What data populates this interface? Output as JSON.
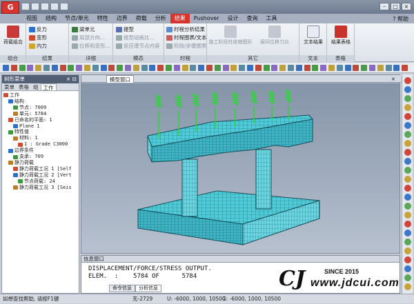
{
  "app": {
    "logo_text": "G"
  },
  "menubar": {
    "tabs": [
      "视图",
      "结构",
      "节点/单元",
      "特性",
      "边界",
      "荷载",
      "分析",
      "结果",
      "Pushover",
      "设计",
      "查询",
      "工具"
    ],
    "active_index": 7,
    "help_label": "帮助"
  },
  "ribbon": {
    "groups": {
      "combo": {
        "label": "组合",
        "button": "荷载组合"
      },
      "result": {
        "label": "结果",
        "items": [
          "反力",
          "变形",
          "内力"
        ],
        "items2": [
          "梁单元",
          "局部方向...",
          "位移和变形..."
        ]
      },
      "detail": {
        "label": "详细"
      },
      "mode": {
        "label": "模态",
        "items": [
          "振型",
          "振型动画比...",
          "反应谱节点内容"
        ]
      },
      "time": {
        "label": "时程",
        "items": [
          "时程分析结果",
          "时程图表/文本",
          "阶段/步骤图表"
        ]
      },
      "other": {
        "label": "其它",
        "items": [
          "施工阶段柱收缩图形",
          "层间位移力比"
        ]
      },
      "text": {
        "label": "文本",
        "button": "文本结果"
      },
      "table": {
        "label": "表格",
        "button": "结果表格"
      }
    }
  },
  "left_panel": {
    "title": "树形菜单",
    "tabs": [
      "菜单",
      "表格",
      "组",
      "工作"
    ],
    "active_tab": 3,
    "tree": [
      {
        "level": 0,
        "text": "工作"
      },
      {
        "level": 1,
        "text": "结构"
      },
      {
        "level": 2,
        "text": "节点: 7009"
      },
      {
        "level": 2,
        "text": "单元: 5784"
      },
      {
        "level": 1,
        "text": "已命名的平面: 1"
      },
      {
        "level": 2,
        "text": "Plane 1"
      },
      {
        "level": 1,
        "text": "特性值"
      },
      {
        "level": 2,
        "text": "材料: 1"
      },
      {
        "level": 3,
        "text": "1 : Grade C3000"
      },
      {
        "level": 1,
        "text": "边界条件"
      },
      {
        "level": 2,
        "text": "支承: 709"
      },
      {
        "level": 1,
        "text": "静力荷载"
      },
      {
        "level": 2,
        "text": "静力荷载工况 1 [Self"
      },
      {
        "level": 2,
        "text": "静力荷载工况 2 [Vert"
      },
      {
        "level": 3,
        "text": "节点荷载: 24"
      },
      {
        "level": 2,
        "text": "静力荷载工况 3 [Seis"
      }
    ]
  },
  "viewport": {
    "tab_label": "模型窗口"
  },
  "info_panel": {
    "title": "信息窗口",
    "lines": [
      "DISPLACEMENT/FORCE/STRESS OUTPUT.",
      "ELEM.  :    5784 OF      5784"
    ],
    "tabs": [
      "命令信息",
      "分析信息"
    ],
    "active_tab": 1
  },
  "status": {
    "hint": "如想查找帮助, 请按F1键",
    "node": "无-2729",
    "u": "U: -6000, 1000, 10500",
    "g": "G: -6000, 1000, 10500"
  },
  "watermark": {
    "since": "SINCE 2015",
    "url": "www.jdcui.com",
    "logo": "CJ"
  },
  "colors": {
    "accent": "#d8332c",
    "mesh": "#45c8d6",
    "load": "#2fd43a"
  }
}
